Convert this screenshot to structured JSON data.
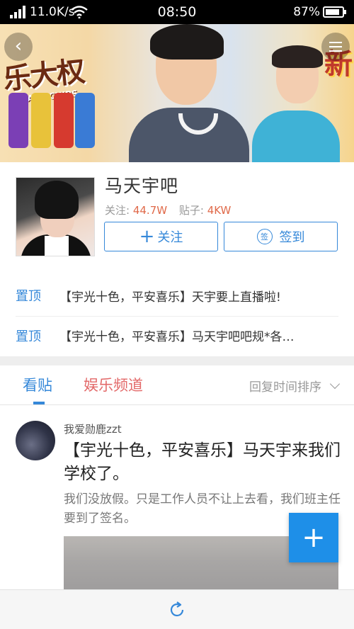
{
  "status_bar": {
    "speed": "11.0K/s",
    "time": "08:50",
    "battery": "87%",
    "battery_level": 0.87
  },
  "banner": {
    "brand_text": "乐大权",
    "brand_sub": "POTATO CHIPS",
    "corner_text": "新"
  },
  "forum": {
    "name": "马天宇吧",
    "followers_label": "关注:",
    "followers_value": "44.7W",
    "posts_label": "贴子:",
    "posts_value": "4KW",
    "follow_button": "关注",
    "signin_icon_text": "签",
    "signin_button": "签到"
  },
  "pinned": [
    {
      "tag": "置顶",
      "text": "【宇光十色，平安喜乐】天宇要上直播啦!"
    },
    {
      "tag": "置顶",
      "text": "【宇光十色，平安喜乐】马天宇吧吧规*各…"
    }
  ],
  "tabs": {
    "posts": "看贴",
    "entertainment": "娱乐频道",
    "sort": "回复时间排序"
  },
  "post": {
    "username": "我爱勋鹿zzt",
    "title": "【宇光十色，平安喜乐】马天宇来我们学校了。",
    "body": "我们没放假。只是工作人员不让上去看，我们班主任要到了签名。"
  },
  "fab": {
    "label": "+"
  },
  "colors": {
    "accent": "#3588d9",
    "highlight": "#e06a4a",
    "channel": "#e36a6a",
    "fab": "#1e8fe8"
  }
}
